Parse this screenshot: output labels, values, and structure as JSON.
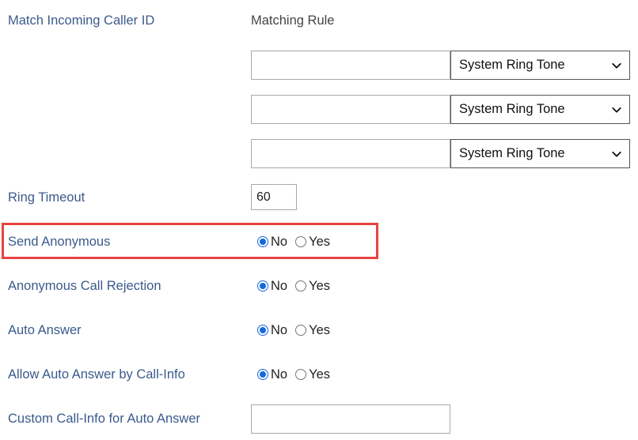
{
  "form": {
    "title_label": "Match Incoming Caller ID",
    "column_header": "Matching Rule",
    "matching_rules": [
      {
        "value": "",
        "placeholder": "",
        "ringtone": "System Ring Tone"
      },
      {
        "value": "",
        "placeholder": "",
        "ringtone": "System Ring Tone"
      },
      {
        "value": "",
        "placeholder": "",
        "ringtone": "System Ring Tone"
      }
    ],
    "ring_timeout": {
      "label": "Ring Timeout",
      "value": "60",
      "placeholder": ""
    },
    "send_anonymous": {
      "label": "Send Anonymous",
      "options": [
        "No",
        "Yes"
      ],
      "selected": "No",
      "highlighted": true
    },
    "anonymous_call_rejection": {
      "label": "Anonymous Call Rejection",
      "options": [
        "No",
        "Yes"
      ],
      "selected": "No"
    },
    "auto_answer": {
      "label": "Auto Answer",
      "options": [
        "No",
        "Yes"
      ],
      "selected": "No"
    },
    "allow_auto_answer_by_call_info": {
      "label": "Allow Auto Answer by Call-Info",
      "options": [
        "No",
        "Yes"
      ],
      "selected": "No"
    },
    "custom_call_info": {
      "label": "Custom Call-Info for Auto Answer",
      "value": "",
      "placeholder": ""
    },
    "icons": {
      "dropdown": "chevron-down-icon"
    },
    "colors": {
      "label_blue": "#3a5a8c",
      "header_gray": "#444444",
      "radio_accent": "#1668dc",
      "highlight_red": "#e8423f",
      "input_border": "#a9a9a9",
      "select_border": "#555555"
    }
  }
}
